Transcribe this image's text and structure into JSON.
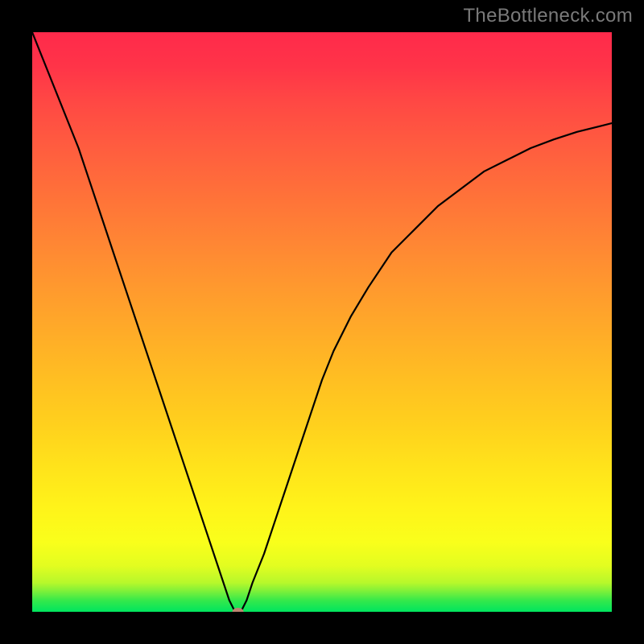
{
  "watermark": "TheBottleneck.com",
  "chart_data": {
    "type": "line",
    "title": "",
    "xlabel": "",
    "ylabel": "",
    "xlim": [
      0,
      100
    ],
    "ylim": [
      0,
      100
    ],
    "series": [
      {
        "name": "bottleneck-curve",
        "x": [
          0,
          2,
          4,
          6,
          8,
          10,
          12,
          14,
          16,
          18,
          20,
          22,
          24,
          26,
          28,
          30,
          32,
          33,
          34,
          35,
          36,
          37,
          38,
          40,
          42,
          44,
          46,
          48,
          50,
          52,
          55,
          58,
          62,
          66,
          70,
          74,
          78,
          82,
          86,
          90,
          94,
          98,
          100
        ],
        "y": [
          100,
          95,
          90,
          85,
          80,
          74,
          68,
          62,
          56,
          50,
          44,
          38,
          32,
          26,
          20,
          14,
          8,
          5,
          2,
          0,
          0,
          2,
          5,
          10,
          16,
          22,
          28,
          34,
          40,
          45,
          51,
          56,
          62,
          66,
          70,
          73,
          76,
          78,
          80,
          81.5,
          82.8,
          83.8,
          84.3
        ]
      }
    ],
    "annotations": [
      {
        "name": "optimal-point",
        "x": 35.5,
        "y": 0
      }
    ],
    "grid": false,
    "legend": false,
    "background_gradient": {
      "orientation": "vertical",
      "stops": [
        {
          "y": 0,
          "color": "#00e55f"
        },
        {
          "y": 8,
          "color": "#e3fd20"
        },
        {
          "y": 25,
          "color": "#ffe31b"
        },
        {
          "y": 50,
          "color": "#ffb325"
        },
        {
          "y": 75,
          "color": "#ff7a37"
        },
        {
          "y": 100,
          "color": "#ff2a4b"
        }
      ]
    }
  }
}
